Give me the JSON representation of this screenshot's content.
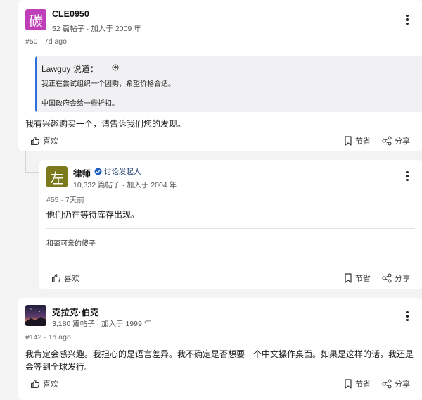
{
  "posts": [
    {
      "avatar": {
        "glyph": "碳",
        "bg": "#c03fb8",
        "fg": "#ffffff"
      },
      "username": "CLE0950",
      "meta": "52 篇帖子 · 加入于 2009 年",
      "post_number": "#50 · 7d ago",
      "quote": {
        "author": "Lawguy 说道：",
        "line1": "我正在尝试组织一个团购，希望价格合适。",
        "line2": "中国政府会给一些折扣。"
      },
      "body": "我有兴趣购买一个，请告诉我们您的发现。",
      "like_label": "喜欢",
      "bookmark_label": "节省",
      "share_label": "分享"
    },
    {
      "avatar": {
        "glyph": "左",
        "bg": "#7a7a1c",
        "fg": "#ffffff"
      },
      "username": "律师",
      "badge": "讨论发起人",
      "meta": "10,332 篇帖子 · 加入于 2004 年",
      "post_number": "#55 · 7天前",
      "body": "他们仍在等待库存出现。",
      "signature": "和蔼可亲的傻子",
      "like_label": "喜欢",
      "bookmark_label": "节省",
      "share_label": "分享"
    },
    {
      "username": "克拉克·伯克",
      "meta": "3,180 篇帖子 · 加入于 1999 年",
      "post_number": "#142 · 1d ago",
      "body_line1": "我肯定会感兴趣。我担心的是语言差异。我不确定是否想要一个中文操作桌面。如果是这样的话，我还是",
      "body_line2": "会等到全球发行。",
      "like_label": "喜欢",
      "bookmark_label": "节省",
      "share_label": "分享"
    }
  ],
  "colors": {
    "accent": "#2e6fd8",
    "page_bg": "#f3f3f4",
    "badge_blue": "#1f5fbf"
  },
  "icons": [
    "kebab-menu-icon",
    "thumbs-up-icon",
    "bookmark-icon",
    "share-icon",
    "verified-badge-icon",
    "quote-expand-icon"
  ]
}
